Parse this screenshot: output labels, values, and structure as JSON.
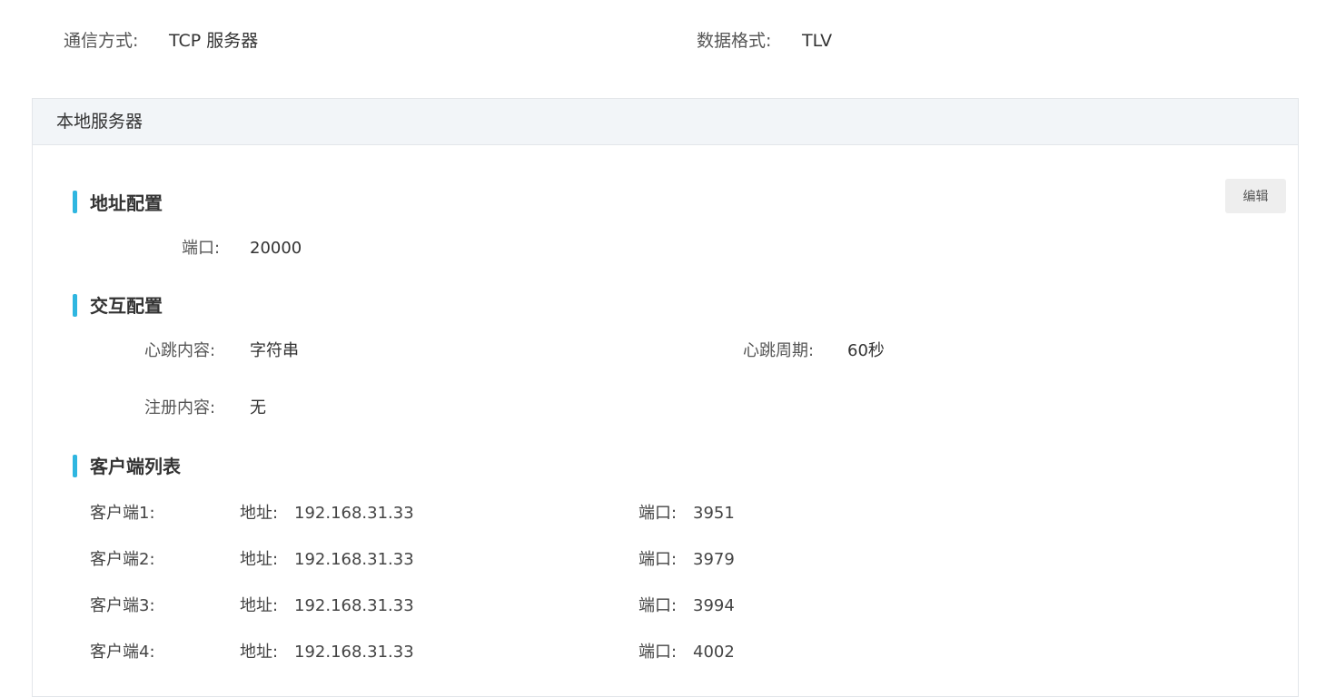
{
  "top": {
    "comm_label": "通信方式:",
    "comm_value": "TCP 服务器",
    "format_label": "数据格式:",
    "format_value": "TLV"
  },
  "panel": {
    "title": "本地服务器",
    "edit_label": "编辑",
    "address_section": {
      "title": "地址配置",
      "port_label": "端口:",
      "port_value": "20000"
    },
    "interact_section": {
      "title": "交互配置",
      "heartbeat_content_label": "心跳内容:",
      "heartbeat_content_value": "字符串",
      "heartbeat_period_label": "心跳周期:",
      "heartbeat_period_value": "60秒",
      "register_content_label": "注册内容:",
      "register_content_value": "无"
    },
    "clients_section": {
      "title": "客户端列表",
      "address_label": "地址:",
      "port_label": "端口:",
      "clients": [
        {
          "name": "客户端1:",
          "address": "192.168.31.33",
          "port": "3951"
        },
        {
          "name": "客户端2:",
          "address": "192.168.31.33",
          "port": "3979"
        },
        {
          "name": "客户端3:",
          "address": "192.168.31.33",
          "port": "3994"
        },
        {
          "name": "客户端4:",
          "address": "192.168.31.33",
          "port": "4002"
        }
      ]
    }
  },
  "colors": {
    "accent": "#2fb6e0",
    "header_bg": "#f2f5f8",
    "button_bg": "#eeeeee"
  }
}
